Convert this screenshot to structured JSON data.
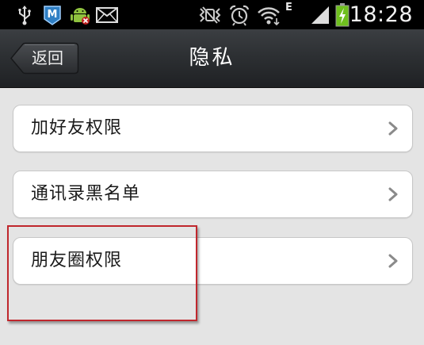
{
  "status_bar": {
    "time": "18:28",
    "network_label": "E",
    "icons": [
      "usb-icon",
      "app-m-icon",
      "android-debug-icon",
      "mail-icon",
      "vibrate-icon",
      "alarm-icon",
      "wifi-icon",
      "signal-icon",
      "battery-charging-icon"
    ]
  },
  "title_bar": {
    "back_label": "返回",
    "title": "隐私"
  },
  "list": {
    "items": [
      {
        "label": "加好友权限"
      },
      {
        "label": "通讯录黑名单"
      },
      {
        "label": "朋友圈权限"
      }
    ]
  },
  "colors": {
    "highlight_border": "#c0272d",
    "title_bar_bg": "#2d3033",
    "battery_green": "#6fc01e"
  }
}
